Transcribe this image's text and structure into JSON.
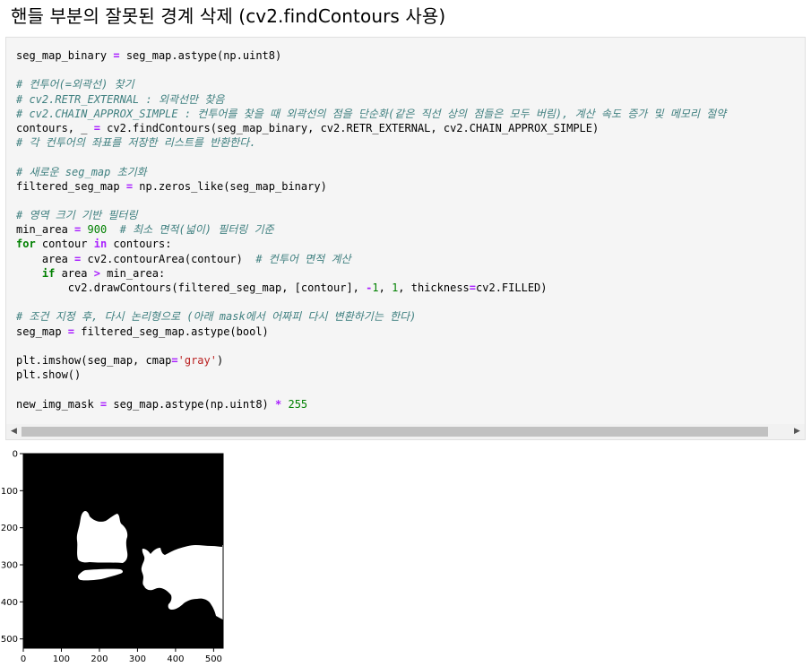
{
  "heading": "핸들 부분의 잘못된 경계 삭제 (cv2.findContours 사용)",
  "code": {
    "lines": [
      [
        {
          "t": "seg_map_binary ",
          "c": ""
        },
        {
          "t": "=",
          "c": "o"
        },
        {
          "t": " seg_map.astype(np.uint8)",
          "c": ""
        }
      ],
      [],
      [
        {
          "t": "# 컨투어(=외곽선) 찾기",
          "c": "c"
        }
      ],
      [
        {
          "t": "# cv2.RETR_EXTERNAL : 외곽선만 찾음",
          "c": "c"
        }
      ],
      [
        {
          "t": "# cv2.CHAIN_APPROX_SIMPLE : 컨투어를 찾을 때 외곽선의 점을 단순화(같은 직선 상의 점들은 모두 버림), 계산 속도 증가 및 메모리 절약",
          "c": "c"
        }
      ],
      [
        {
          "t": "contours, _ ",
          "c": ""
        },
        {
          "t": "=",
          "c": "o"
        },
        {
          "t": " cv2.findContours(seg_map_binary, cv2.RETR_EXTERNAL, cv2.CHAIN_APPROX_SIMPLE)",
          "c": ""
        }
      ],
      [
        {
          "t": "# 각 컨투어의 좌표를 저장한 리스트를 반환한다.",
          "c": "c"
        }
      ],
      [],
      [
        {
          "t": "# 새로운 seg_map 초기화",
          "c": "c"
        }
      ],
      [
        {
          "t": "filtered_seg_map ",
          "c": ""
        },
        {
          "t": "=",
          "c": "o"
        },
        {
          "t": " np.zeros_like(seg_map_binary)",
          "c": ""
        }
      ],
      [],
      [
        {
          "t": "# 영역 크기 기반 필터링",
          "c": "c"
        }
      ],
      [
        {
          "t": "min_area ",
          "c": ""
        },
        {
          "t": "=",
          "c": "o"
        },
        {
          "t": " ",
          "c": ""
        },
        {
          "t": "900",
          "c": "n"
        },
        {
          "t": "  ",
          "c": ""
        },
        {
          "t": "# 최소 면적(넓이) 필터링 기준",
          "c": "c"
        }
      ],
      [
        {
          "t": "for",
          "c": "k"
        },
        {
          "t": " contour ",
          "c": ""
        },
        {
          "t": "in",
          "c": "o"
        },
        {
          "t": " contours:",
          "c": ""
        }
      ],
      [
        {
          "t": "    area ",
          "c": ""
        },
        {
          "t": "=",
          "c": "o"
        },
        {
          "t": " cv2.contourArea(contour)  ",
          "c": ""
        },
        {
          "t": "# 컨투어 면적 계산",
          "c": "c"
        }
      ],
      [
        {
          "t": "    ",
          "c": ""
        },
        {
          "t": "if",
          "c": "k"
        },
        {
          "t": " area ",
          "c": ""
        },
        {
          "t": ">",
          "c": "o"
        },
        {
          "t": " min_area:",
          "c": ""
        }
      ],
      [
        {
          "t": "        cv2.drawContours(filtered_seg_map, [contour], ",
          "c": ""
        },
        {
          "t": "-",
          "c": "o"
        },
        {
          "t": "1",
          "c": "n"
        },
        {
          "t": ", ",
          "c": ""
        },
        {
          "t": "1",
          "c": "n"
        },
        {
          "t": ", thickness",
          "c": ""
        },
        {
          "t": "=",
          "c": "o"
        },
        {
          "t": "cv2.FILLED)",
          "c": ""
        }
      ],
      [],
      [
        {
          "t": "# 조건 지정 후, 다시 논리형으로 (아래 mask에서 어짜피 다시 변환하기는 한다)",
          "c": "c"
        }
      ],
      [
        {
          "t": "seg_map ",
          "c": ""
        },
        {
          "t": "=",
          "c": "o"
        },
        {
          "t": " filtered_seg_map.astype(bool)",
          "c": ""
        }
      ],
      [],
      [
        {
          "t": "plt.imshow(seg_map, cmap",
          "c": ""
        },
        {
          "t": "=",
          "c": "o"
        },
        {
          "t": "'gray'",
          "c": "s"
        },
        {
          "t": ")",
          "c": ""
        }
      ],
      [
        {
          "t": "plt.show()",
          "c": ""
        }
      ],
      [],
      [
        {
          "t": "new_img_mask ",
          "c": ""
        },
        {
          "t": "=",
          "c": "o"
        },
        {
          "t": " seg_map.astype(np.uint8) ",
          "c": ""
        },
        {
          "t": "*",
          "c": "o"
        },
        {
          "t": " ",
          "c": ""
        },
        {
          "t": "255",
          "c": "n"
        }
      ]
    ]
  },
  "scrollbar": {
    "left_arrow": "◀",
    "right_arrow": "▶"
  },
  "plot": {
    "image_description_name": "segmentation-mask-image",
    "cmap": "gray",
    "y_ticks": [
      "0",
      "100",
      "200",
      "300",
      "400",
      "500"
    ],
    "x_ticks": [
      "0",
      "100",
      "200",
      "300",
      "400",
      "500"
    ]
  }
}
